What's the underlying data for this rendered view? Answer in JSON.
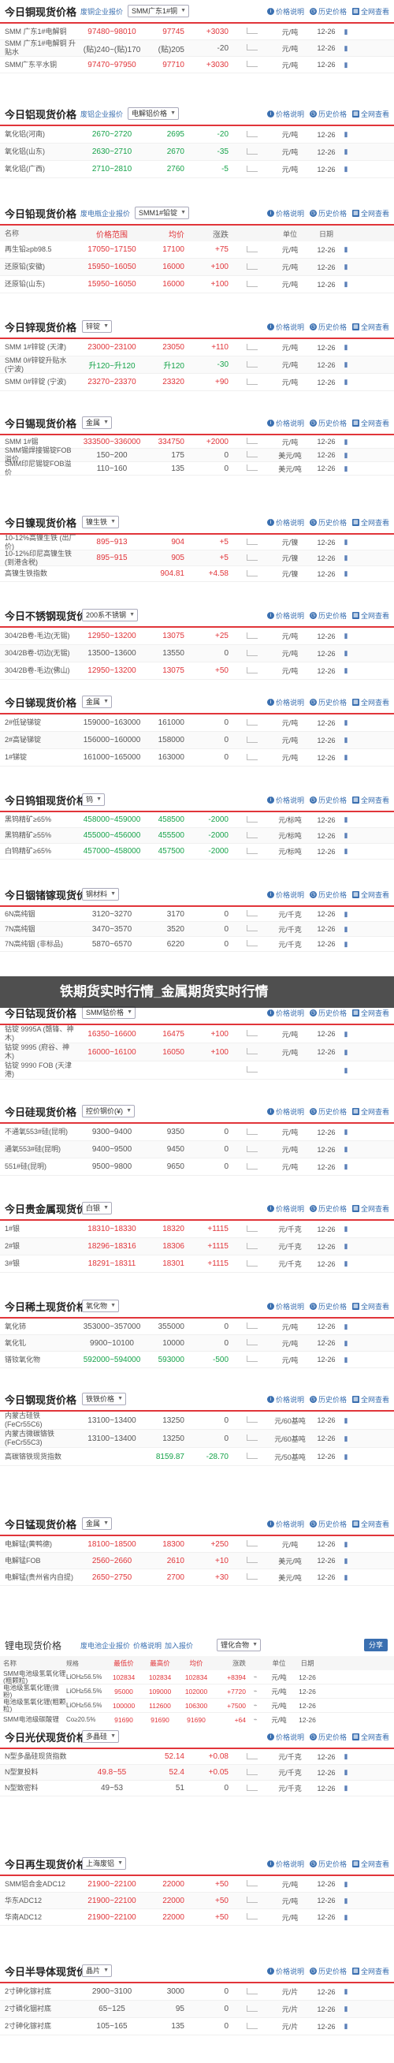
{
  "banner_text": "铁期货实时行情_金属期货实时行情",
  "header_buttons": {
    "explain": "价格说明",
    "history": "历史价格",
    "full": "全网查看"
  },
  "col_headers": {
    "name": "名称",
    "range": "价格范围",
    "avg": "均价",
    "change": "涨跌",
    "unit": "单位",
    "date": "日期"
  },
  "sections": [
    {
      "id": "copper",
      "title": "今日铜现货价格",
      "tag": "废铜企业报价",
      "select": "SMM广东1#铜",
      "rows": [
        {
          "name": "SMM 广东1#电解铜",
          "range": "97480~98010",
          "avg": "97745",
          "change": "+3030",
          "dir": "up",
          "unit": "元/吨",
          "date": "12-26"
        },
        {
          "name": "SMM 广东1#电解铜 升贴水",
          "range": "(贴)240~(贴)170",
          "avg": "(贴)205",
          "change": "-20",
          "dir": "nt",
          "unit": "元/吨",
          "date": "12-26",
          "neutral": true
        },
        {
          "name": "SMM广东平水铜",
          "range": "97470~97950",
          "avg": "97710",
          "change": "+3030",
          "dir": "up",
          "unit": "元/吨",
          "date": "12-26"
        }
      ]
    },
    {
      "id": "aluminum",
      "title": "今日铝现货价格",
      "tag": "废铝企业报价",
      "select": "电解铝价格",
      "rows": [
        {
          "name": "氧化铝(河南)",
          "range": "2670~2720",
          "avg": "2695",
          "change": "-20",
          "dir": "dn",
          "unit": "元/吨",
          "date": "12-26",
          "green": true
        },
        {
          "name": "氧化铝(山东)",
          "range": "2630~2710",
          "avg": "2670",
          "change": "-35",
          "dir": "dn",
          "unit": "元/吨",
          "date": "12-26",
          "green": true
        },
        {
          "name": "氧化铝(广西)",
          "range": "2710~2810",
          "avg": "2760",
          "change": "-5",
          "dir": "dn",
          "unit": "元/吨",
          "date": "12-26",
          "green": true
        }
      ]
    },
    {
      "id": "lead",
      "title": "今日铅现货价格",
      "tag": "废电瓶企业报价",
      "select": "SMM1#铅锭",
      "colhead": true,
      "rows": [
        {
          "name": "再生铅≥pb98.5",
          "range": "17050~17150",
          "avg": "17100",
          "change": "+75",
          "dir": "up",
          "unit": "元/吨",
          "date": "12-26"
        },
        {
          "name": "还原铅(安徽)",
          "range": "15950~16050",
          "avg": "16000",
          "change": "+100",
          "dir": "up",
          "unit": "元/吨",
          "date": "12-26"
        },
        {
          "name": "还原铅(山东)",
          "range": "15950~16050",
          "avg": "16000",
          "change": "+100",
          "dir": "up",
          "unit": "元/吨",
          "date": "12-26"
        }
      ]
    },
    {
      "id": "zinc",
      "title": "今日锌现货价格",
      "tag": "",
      "select": "锌锭",
      "rows": [
        {
          "name": "SMM 1#锌锭 (天津)",
          "range": "23000~23100",
          "avg": "23050",
          "change": "+110",
          "dir": "up",
          "unit": "元/吨",
          "date": "12-26"
        },
        {
          "name": "SMM 0#锌锭升贴水 (宁波)",
          "range": "升120~升120",
          "avg": "升120",
          "change": "-30",
          "dir": "dn",
          "unit": "元/吨",
          "date": "12-26",
          "green": true
        },
        {
          "name": "SMM 0#锌锭 (宁波)",
          "range": "23270~23370",
          "avg": "23320",
          "change": "+90",
          "dir": "up",
          "unit": "元/吨",
          "date": "12-26"
        }
      ]
    },
    {
      "id": "tin",
      "title": "今日锡现货价格",
      "tag": "",
      "select": "金属",
      "rows": [
        {
          "name": "SMM 1#锡",
          "range": "333500~336000",
          "avg": "334750",
          "change": "+2000",
          "dir": "up",
          "unit": "元/吨",
          "date": "12-26"
        },
        {
          "name": "SMM锡焊接锡锭FOB溢价",
          "range": "150~200",
          "avg": "175",
          "change": "0",
          "dir": "nt",
          "unit": "美元/吨",
          "date": "12-26",
          "neutral": true
        },
        {
          "name": "SMM印尼锡锭FOB溢价",
          "range": "110~160",
          "avg": "135",
          "change": "0",
          "dir": "nt",
          "unit": "美元/吨",
          "date": "12-26",
          "neutral": true
        }
      ]
    },
    {
      "id": "nickel",
      "title": "今日镍现货价格",
      "tag": "",
      "select": "镍生铁",
      "rows": [
        {
          "name": "10-12%高镍生铁 (出厂价)",
          "range": "895~913",
          "avg": "904",
          "change": "+5",
          "dir": "up",
          "unit": "元/镍",
          "date": "12-26"
        },
        {
          "name": "10-12%印尼高镍生铁(到港含税)",
          "range": "895~915",
          "avg": "905",
          "change": "+5",
          "dir": "up",
          "unit": "元/镍",
          "date": "12-26"
        },
        {
          "name": "高镍生铁指数",
          "range": "",
          "avg": "904.81",
          "change": "+4.58",
          "dir": "up",
          "unit": "元/镍",
          "date": "12-26"
        }
      ]
    },
    {
      "id": "stainless",
      "title": "今日不锈钢现货价格",
      "tag": "",
      "select": "200系不锈钢",
      "rows": [
        {
          "name": "304/2B卷-毛边(无锡)",
          "range": "12950~13200",
          "avg": "13075",
          "change": "+25",
          "dir": "up",
          "unit": "元/吨",
          "date": "12-26"
        },
        {
          "name": "304/2B卷-切边(无锡)",
          "range": "13500~13600",
          "avg": "13550",
          "change": "0",
          "dir": "nt",
          "unit": "元/吨",
          "date": "12-26",
          "neutral": true
        },
        {
          "name": "304/2B卷-毛边(佛山)",
          "range": "12950~13200",
          "avg": "13075",
          "change": "+50",
          "dir": "up",
          "unit": "元/吨",
          "date": "12-26"
        }
      ]
    },
    {
      "id": "antimony",
      "title": "今日锑现货价格",
      "tag": "",
      "select": "金属",
      "rows": [
        {
          "name": "2#低铋锑锭",
          "range": "159000~163000",
          "avg": "161000",
          "change": "0",
          "dir": "nt",
          "unit": "元/吨",
          "date": "12-26",
          "neutral": true
        },
        {
          "name": "2#高铋锑锭",
          "range": "156000~160000",
          "avg": "158000",
          "change": "0",
          "dir": "nt",
          "unit": "元/吨",
          "date": "12-26",
          "neutral": true
        },
        {
          "name": "1#锑锭",
          "range": "161000~165000",
          "avg": "163000",
          "change": "0",
          "dir": "nt",
          "unit": "元/吨",
          "date": "12-26",
          "neutral": true
        }
      ]
    },
    {
      "id": "tungsten",
      "title": "今日钨钼现货价格",
      "tag": "",
      "select": "钨",
      "rows": [
        {
          "name": "黑钨精矿≥65%",
          "range": "458000~459000",
          "avg": "458500",
          "change": "-2000",
          "dir": "dn",
          "unit": "元/标吨",
          "date": "12-26",
          "green": true
        },
        {
          "name": "黑钨精矿≥55%",
          "range": "455000~456000",
          "avg": "455500",
          "change": "-2000",
          "dir": "dn",
          "unit": "元/标吨",
          "date": "12-26",
          "green": true
        },
        {
          "name": "白钨精矿≥65%",
          "range": "457000~458000",
          "avg": "457500",
          "change": "-2000",
          "dir": "dn",
          "unit": "元/标吨",
          "date": "12-26",
          "green": true
        }
      ]
    },
    {
      "id": "indium",
      "title": "今日铟锗镓现货价格",
      "tag": "",
      "select": "钢材料",
      "rows": [
        {
          "name": "6N高纯铟",
          "range": "3120~3270",
          "avg": "3170",
          "change": "0",
          "dir": "nt",
          "unit": "元/千克",
          "date": "12-26",
          "neutral": true
        },
        {
          "name": "7N高纯铟",
          "range": "3470~3570",
          "avg": "3520",
          "change": "0",
          "dir": "nt",
          "unit": "元/千克",
          "date": "12-26",
          "neutral": true
        },
        {
          "name": "7N高纯铟 (非标品)",
          "range": "5870~6570",
          "avg": "6220",
          "change": "0",
          "dir": "nt",
          "unit": "元/千克",
          "date": "12-26",
          "neutral": true
        }
      ]
    },
    {
      "id": "cobalt",
      "title": "今日钴现货价格",
      "tag": "",
      "select": "SMM钴价格",
      "rows": [
        {
          "name": "钴锭 9995A (赣锋、神木)",
          "range": "16350~16600",
          "avg": "16475",
          "change": "+100",
          "dir": "up",
          "unit": "元/吨",
          "date": "12-26"
        },
        {
          "name": "钴锭 9995 (府谷、神木)",
          "range": "16000~16100",
          "avg": "16050",
          "change": "+100",
          "dir": "up",
          "unit": "元/吨",
          "date": "12-26"
        },
        {
          "name": "钴锭 9990 FOB (天津港)",
          "range": "",
          "avg": "",
          "change": "",
          "dir": "nt",
          "unit": "",
          "date": "",
          "neutral": true
        }
      ]
    },
    {
      "id": "silicon",
      "title": "今日硅现货价格",
      "tag": "",
      "select": "控价钢价(¥)",
      "rows": [
        {
          "name": "不通氧553#硅(昆明)",
          "range": "9300~9400",
          "avg": "9350",
          "change": "0",
          "dir": "nt",
          "unit": "元/吨",
          "date": "12-26",
          "neutral": true
        },
        {
          "name": "通氧553#硅(昆明)",
          "range": "9400~9500",
          "avg": "9450",
          "change": "0",
          "dir": "nt",
          "unit": "元/吨",
          "date": "12-26",
          "neutral": true
        },
        {
          "name": "551#硅(昆明)",
          "range": "9500~9800",
          "avg": "9650",
          "change": "0",
          "dir": "nt",
          "unit": "元/吨",
          "date": "12-26",
          "neutral": true
        }
      ]
    },
    {
      "id": "precious",
      "title": "今日贵金属现货价格",
      "tag": "",
      "select": "白银",
      "rows": [
        {
          "name": "1#银",
          "range": "18310~18330",
          "avg": "18320",
          "change": "+1115",
          "dir": "up",
          "unit": "元/千克",
          "date": "12-26"
        },
        {
          "name": "2#银",
          "range": "18296~18316",
          "avg": "18306",
          "change": "+1115",
          "dir": "up",
          "unit": "元/千克",
          "date": "12-26"
        },
        {
          "name": "3#银",
          "range": "18291~18311",
          "avg": "18301",
          "change": "+1115",
          "dir": "up",
          "unit": "元/千克",
          "date": "12-26"
        }
      ]
    },
    {
      "id": "rareearth",
      "title": "今日稀土现货价格",
      "tag": "",
      "select": "氧化物",
      "rows": [
        {
          "name": "氧化铈",
          "range": "353000~357000",
          "avg": "355000",
          "change": "0",
          "dir": "nt",
          "unit": "元/吨",
          "date": "12-26",
          "neutral": true
        },
        {
          "name": "氧化钆",
          "range": "9900~10100",
          "avg": "10000",
          "change": "0",
          "dir": "nt",
          "unit": "元/吨",
          "date": "12-26",
          "neutral": true
        },
        {
          "name": "镨钕氧化物",
          "range": "592000~594000",
          "avg": "593000",
          "change": "-500",
          "dir": "dn",
          "unit": "元/吨",
          "date": "12-26",
          "green": true
        }
      ]
    },
    {
      "id": "steel",
      "title": "今日钢现货价格",
      "tag": "",
      "select": "铁铁价格",
      "rows": [
        {
          "name": "内蒙古硅铁(FeCr55C6)",
          "range": "13100~13400",
          "avg": "13250",
          "change": "0",
          "dir": "nt",
          "unit": "元/60基吨",
          "date": "12-26",
          "neutral": true
        },
        {
          "name": "内蒙古微碳铬铁(FeCr55C3)",
          "range": "13100~13400",
          "avg": "13250",
          "change": "0",
          "dir": "nt",
          "unit": "元/60基吨",
          "date": "12-26",
          "neutral": true
        },
        {
          "name": "高碳铬铁现货指数",
          "range": "",
          "avg": "8159.87",
          "change": "-28.70",
          "dir": "dn",
          "unit": "元/50基吨",
          "date": "12-26",
          "green": true
        }
      ]
    },
    {
      "id": "manganese",
      "title": "今日锰现货价格",
      "tag": "",
      "select": "金属",
      "rows": [
        {
          "name": "电解锰(黄鸭德)",
          "range": "18100~18500",
          "avg": "18300",
          "change": "+250",
          "dir": "up",
          "unit": "元/吨",
          "date": "12-26"
        },
        {
          "name": "电解锰FOB",
          "range": "2560~2660",
          "avg": "2610",
          "change": "+10",
          "dir": "up",
          "unit": "美元/吨",
          "date": "12-26"
        },
        {
          "name": "电解锰(贵州省内自提)",
          "range": "2650~2750",
          "avg": "2700",
          "change": "+30",
          "dir": "up",
          "unit": "美元/吨",
          "date": "12-26"
        }
      ]
    }
  ],
  "battery": {
    "title": "锂电现货价格",
    "tag": "废电池企业报价",
    "links": [
      "价格说明",
      "加入报价"
    ],
    "select": "锂化合物",
    "share": "分享",
    "head": [
      "名称",
      "规格",
      "最低价",
      "最高价",
      "均价",
      "涨跌",
      "",
      "单位",
      "日期"
    ],
    "rows": [
      {
        "n": "SMM电池级氢氧化锂(粗颗粒)",
        "s": "LiOH≥56.5%",
        "lo": "102834",
        "hi": "102834",
        "avg": "102834",
        "chg": "+8394",
        "dir": "up",
        "u": "元/吨",
        "d": "12-26"
      },
      {
        "n": "电池级氢氧化锂(微粉)",
        "s": "LiOH≥56.5%",
        "lo": "95000",
        "hi": "109000",
        "avg": "102000",
        "chg": "+7720",
        "dir": "up",
        "u": "元/吨",
        "d": "12-26"
      },
      {
        "n": "电池级氢氧化锂(粗颗粒)",
        "s": "LiOH≥56.5%",
        "lo": "100000",
        "hi": "112600",
        "avg": "106300",
        "chg": "+7500",
        "dir": "up",
        "u": "元/吨",
        "d": "12-26"
      },
      {
        "n": "SMM电池级碳酸锂",
        "s": "Co≥20.5%",
        "lo": "91690",
        "hi": "91690",
        "avg": "91690",
        "chg": "+64",
        "dir": "up",
        "u": "元/吨",
        "d": "12-26"
      },
      {
        "n": "钴酸锂",
        "s": "Co≥20.5%",
        "lo": "91690",
        "hi": "91690",
        "avg": "91690",
        "chg": "+64",
        "dir": "up",
        "u": "元/吨",
        "d": "12-26"
      },
      {
        "n": "四氧化三钴",
        "s": "Co≥72.8%",
        "lo": "355000",
        "hi": "365000",
        "avg": "360000",
        "chg": "0",
        "dir": "nt",
        "u": "元/吨",
        "d": "12-26"
      }
    ]
  },
  "sections2": [
    {
      "id": "pv",
      "title": "今日光伏现货价格",
      "select": "多晶硅",
      "rows": [
        {
          "name": "N型多晶硅现货指数",
          "range": "",
          "avg": "52.14",
          "change": "+0.08",
          "dir": "up",
          "unit": "元/千克",
          "date": "12-26"
        },
        {
          "name": "N型复投料",
          "range": "49.8~55",
          "avg": "52.4",
          "change": "+0.05",
          "dir": "up",
          "unit": "元/千克",
          "date": "12-26"
        },
        {
          "name": "N型致密料",
          "range": "49~53",
          "avg": "51",
          "change": "0",
          "dir": "nt",
          "unit": "元/千克",
          "date": "12-26",
          "neutral": true
        }
      ]
    },
    {
      "id": "recycle",
      "title": "今日再生现货价格",
      "select": "上海废铝",
      "rows": [
        {
          "name": "SMM铝合金ADC12",
          "range": "21900~22100",
          "avg": "22000",
          "change": "+50",
          "dir": "up",
          "unit": "元/吨",
          "date": "12-26"
        },
        {
          "name": "华东ADC12",
          "range": "21900~22100",
          "avg": "22000",
          "change": "+50",
          "dir": "up",
          "unit": "元/吨",
          "date": "12-26"
        },
        {
          "name": "华南ADC12",
          "range": "21900~22100",
          "avg": "22000",
          "change": "+50",
          "dir": "up",
          "unit": "元/吨",
          "date": "12-26"
        }
      ]
    },
    {
      "id": "semi",
      "title": "今日半导体现货价格",
      "select": "晶片",
      "rows": [
        {
          "name": "2寸砷化镓衬底",
          "range": "2900~3100",
          "avg": "3000",
          "change": "0",
          "dir": "nt",
          "unit": "元/片",
          "date": "12-26",
          "neutral": true
        },
        {
          "name": "2寸磷化铟衬底",
          "range": "65~125",
          "avg": "95",
          "change": "0",
          "dir": "nt",
          "unit": "元/片",
          "date": "12-26",
          "neutral": true
        },
        {
          "name": "2寸砷化镓衬底",
          "range": "105~165",
          "avg": "135",
          "change": "0",
          "dir": "nt",
          "unit": "元/片",
          "date": "12-26",
          "neutral": true
        }
      ]
    }
  ]
}
